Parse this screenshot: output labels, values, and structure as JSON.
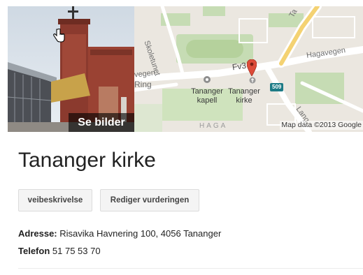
{
  "photo": {
    "label": "Se bilder",
    "icon": "hand-pointer-icon"
  },
  "map": {
    "roads": {
      "skoletunet": "Skoletunet",
      "fv": "Fv3",
      "hagavegen": "Hagavegen",
      "vegen_left": "vegen",
      "ring": "Ring",
      "top_road": "Ta",
      "lange": "Lang"
    },
    "poi_kapell": "Tananger kapell",
    "poi_kirke": "Tananger kirke",
    "route_number": "509",
    "district": "HAGA",
    "attribution": "Map data ©2013 Google",
    "marker_color": "#dd4b39"
  },
  "place": {
    "title": "Tananger kirke"
  },
  "actions": {
    "directions": "veibeskrivelse",
    "rate": "Rediger vurderingen"
  },
  "details": {
    "address_label": "Adresse:",
    "address_value": "Risavika Havnering 100, 4056 Tananger",
    "phone_label": "Telefon",
    "phone_value": "51 75 53 70"
  }
}
